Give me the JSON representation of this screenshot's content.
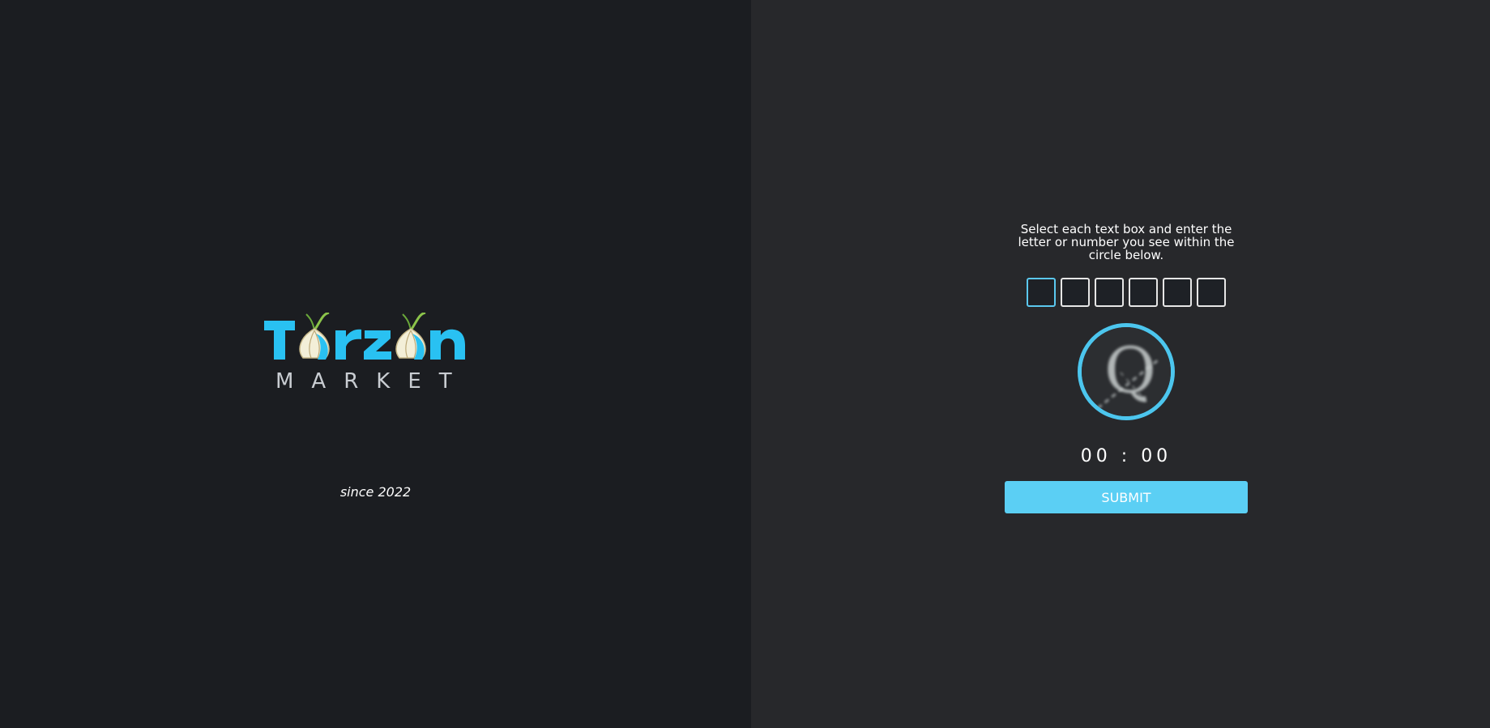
{
  "logo": {
    "word": "Torzon",
    "subtitle": "MARKET",
    "since": "since 2022",
    "brand_color": "#29c1f2"
  },
  "captcha": {
    "instructions": "Select each text box and enter the letter or number you see within the circle below.",
    "box_count": 6,
    "box_values": [
      "",
      "",
      "",
      "",
      "",
      ""
    ],
    "circle_glyph": "Q",
    "timer": "00 : 00",
    "submit_label": "SUBMIT",
    "accent_color": "#5bcff4"
  },
  "colors": {
    "left_bg": "#1b1d21",
    "right_bg": "#27282b"
  }
}
